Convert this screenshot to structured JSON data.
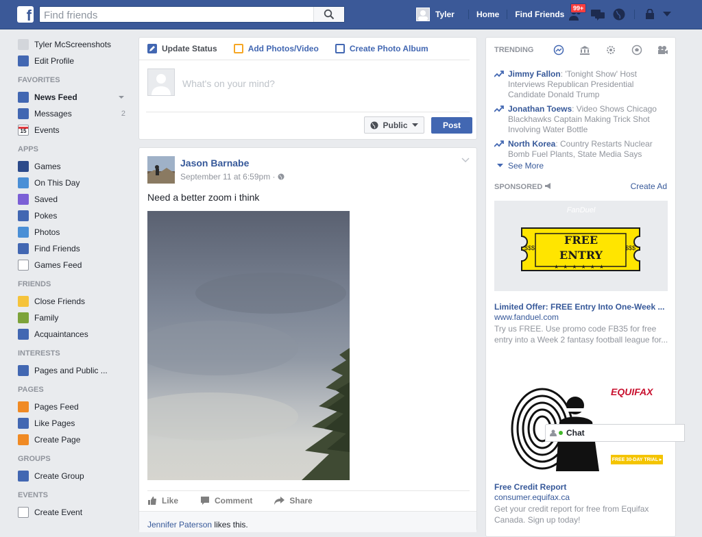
{
  "topbar": {
    "logo_letter": "f",
    "search_placeholder": "Find friends",
    "user_name": "Tyler",
    "home_label": "Home",
    "find_friends_label": "Find Friends",
    "notification_badge": "99+",
    "brand_color": "#3b5998"
  },
  "leftnav": {
    "profile": [
      {
        "label": "Tyler McScreenshots",
        "icon": "profile-picture"
      },
      {
        "label": "Edit Profile",
        "icon": "pencil-icon"
      }
    ],
    "sections": [
      {
        "heading": "FAVORITES",
        "items": [
          {
            "label": "News Feed",
            "icon": "news-feed-icon",
            "active": true
          },
          {
            "label": "Messages",
            "icon": "messages-icon",
            "count": "2"
          },
          {
            "label": "Events",
            "icon": "calendar-icon",
            "icon_text": "15"
          }
        ]
      },
      {
        "heading": "APPS",
        "items": [
          {
            "label": "Games",
            "icon": "games-icon"
          },
          {
            "label": "On This Day",
            "icon": "on-this-day-icon"
          },
          {
            "label": "Saved",
            "icon": "saved-icon"
          },
          {
            "label": "Pokes",
            "icon": "pokes-icon"
          },
          {
            "label": "Photos",
            "icon": "photos-icon"
          },
          {
            "label": "Find Friends",
            "icon": "find-friends-icon"
          },
          {
            "label": "Games Feed",
            "icon": "gamepad-icon"
          }
        ]
      },
      {
        "heading": "FRIENDS",
        "items": [
          {
            "label": "Close Friends",
            "icon": "star-icon"
          },
          {
            "label": "Family",
            "icon": "house-icon"
          },
          {
            "label": "Acquaintances",
            "icon": "acquaintances-icon"
          }
        ]
      },
      {
        "heading": "INTERESTS",
        "items": [
          {
            "label": "Pages and Public ...",
            "icon": "pages-list-icon"
          }
        ]
      },
      {
        "heading": "PAGES",
        "items": [
          {
            "label": "Pages Feed",
            "icon": "pages-feed-icon"
          },
          {
            "label": "Like Pages",
            "icon": "like-pages-icon"
          },
          {
            "label": "Create Page",
            "icon": "create-page-icon"
          }
        ]
      },
      {
        "heading": "GROUPS",
        "items": [
          {
            "label": "Create Group",
            "icon": "create-group-icon"
          }
        ]
      },
      {
        "heading": "EVENTS",
        "items": [
          {
            "label": "Create Event",
            "icon": "create-event-icon"
          }
        ]
      }
    ]
  },
  "composer": {
    "tabs": [
      "Update Status",
      "Add Photos/Video",
      "Create Photo Album"
    ],
    "placeholder": "What's on your mind?",
    "privacy_label": "Public",
    "post_label": "Post"
  },
  "post": {
    "author": "Jason Barnabe",
    "timestamp": "September 11 at 6:59pm · ",
    "text": "Need a better zoom i think",
    "actions": [
      "Like",
      "Comment",
      "Share"
    ],
    "likes_name": "Jennifer Paterson",
    "likes_suffix": " likes this."
  },
  "trending": {
    "heading": "TRENDING",
    "items": [
      {
        "topic": "Jimmy Fallon",
        "desc": ": 'Tonight Show' Host Interviews Republican Presidential Candidate Donald Trump"
      },
      {
        "topic": "Jonathan Toews",
        "desc": ": Video Shows Chicago Blackhawks Captain Making Trick Shot Involving Water Bottle"
      },
      {
        "topic": "North Korea",
        "desc": ": Country Restarts Nuclear Bomb Fuel Plants, State Media Says"
      }
    ],
    "see_more": "See More"
  },
  "sponsored": {
    "heading": "SPONSORED",
    "create_ad": "Create Ad",
    "ads": [
      {
        "image_brand": "FanDuel",
        "ticket_line1": "FREE",
        "ticket_line2": "ENTRY",
        "ticket_side": "$$$",
        "title": "Limited Offer: FREE Entry Into One-Week ...",
        "url": "www.fanduel.com",
        "desc": "Try us FREE. Use promo code FB35 for free entry into a Week 2 fantasy football league for..."
      },
      {
        "image_brand": "EQUIFAX",
        "image_banner": "FREE 30-DAY TRIAL ▸",
        "title": "Free Credit Report",
        "url": "consumer.equifax.ca",
        "desc": "Get your credit report for free from Equifax Canada. Sign up today!"
      }
    ]
  },
  "chat": {
    "label": "Chat"
  }
}
